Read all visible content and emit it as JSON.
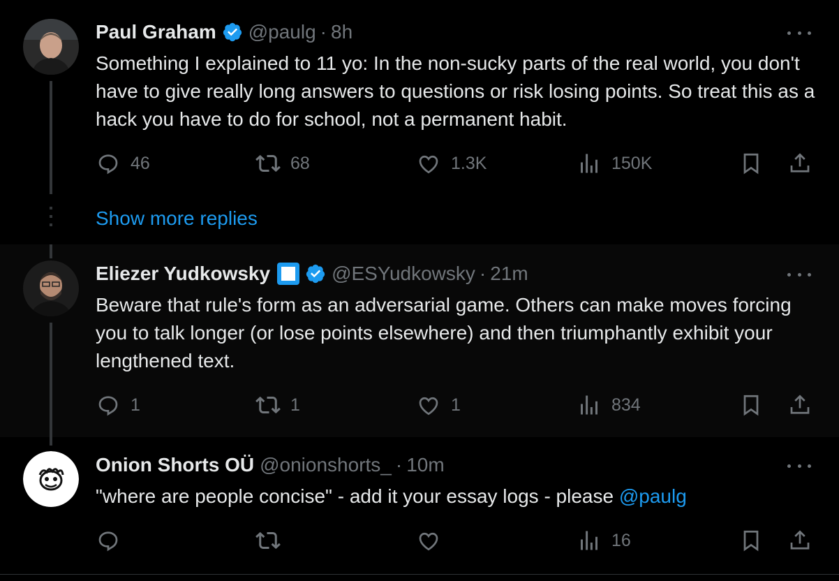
{
  "tweets": [
    {
      "name": "Paul Graham",
      "verified": true,
      "handle": "@paulg",
      "separator": "·",
      "time": "8h",
      "text": "Something I explained to 11 yo: In the non-sucky parts of the real world, you don't have to give really long answers to questions or risk losing points. So treat this as a hack you have to do for school, not a permanent habit.",
      "replies": "46",
      "retweets": "68",
      "likes": "1.3K",
      "views": "150K"
    },
    {
      "name": "Eliezer Yudkowsky",
      "verified": true,
      "handle": "@ESYudkowsky",
      "separator": "·",
      "time": "21m",
      "text": "Beware that rule's form as an adversarial game.  Others can make moves forcing you to talk longer (or lose points elsewhere) and then triumphantly exhibit your lengthened text.",
      "replies": "1",
      "retweets": "1",
      "likes": "1",
      "views": "834"
    },
    {
      "name": "Onion Shorts OÜ",
      "verified": false,
      "handle": "@onionshorts_",
      "separator": "·",
      "time": "10m",
      "text": "\"where are people concise\" - add it your essay logs - please ",
      "mention": "@paulg",
      "replies": "",
      "retweets": "",
      "likes": "",
      "views": "16"
    }
  ],
  "show_more_replies": "Show more replies",
  "colors": {
    "background": "#000000",
    "text": "#e7e9ea",
    "muted": "#71767b",
    "accent": "#1d9bf0",
    "thread_line": "#333639"
  },
  "icons": [
    "verified-badge-icon",
    "square-badge-icon",
    "more-icon",
    "reply-icon",
    "retweet-icon",
    "like-icon",
    "views-icon",
    "bookmark-icon",
    "share-icon"
  ]
}
